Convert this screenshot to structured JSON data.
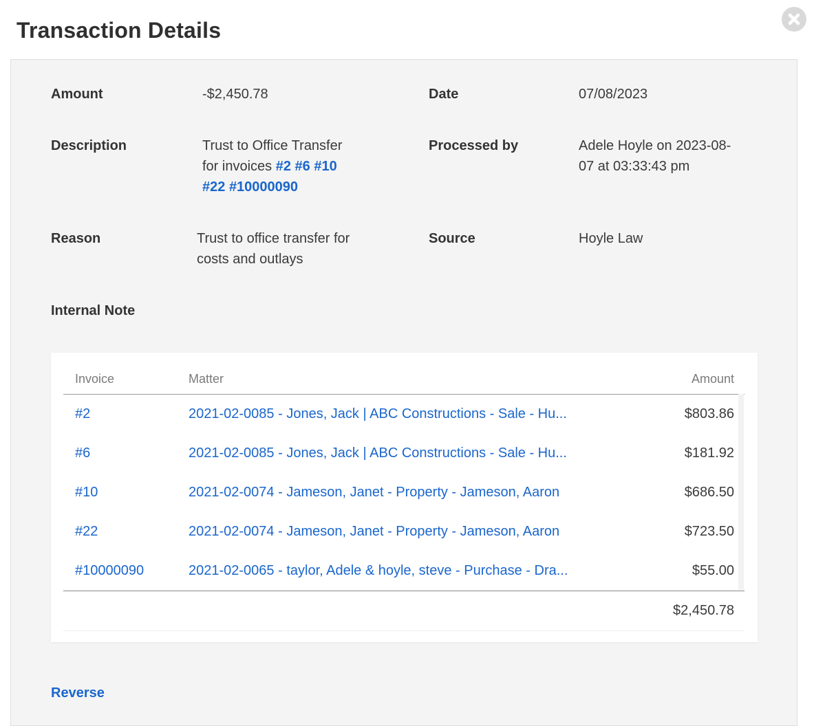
{
  "modal": {
    "title": "Transaction Details",
    "close_icon": "close-circle-icon"
  },
  "details": {
    "amount_label": "Amount",
    "amount_value": "-$2,450.78",
    "date_label": "Date",
    "date_value": "07/08/2023",
    "description_label": "Description",
    "description_text_1": "Trust to Office Transfer",
    "description_text_2": "for invoices",
    "description_links": [
      "#2",
      "#6",
      "#10",
      "#22",
      "#10000090"
    ],
    "processed_by_label": "Processed by",
    "processed_by_line_1": "Adele Hoyle on 2023-08-",
    "processed_by_line_2": "07 at 03:33:43 pm",
    "reason_label": "Reason",
    "reason_line_1": "Trust to office transfer for",
    "reason_line_2": "costs and outlays",
    "source_label": "Source",
    "source_value": "Hoyle Law",
    "internal_note_label": "Internal Note"
  },
  "invoice_table": {
    "columns": [
      "Invoice",
      "Matter",
      "Amount"
    ],
    "rows": [
      {
        "invoice": "#2",
        "matter": "2021-02-0085 - Jones, Jack | ABC Constructions - Sale - Hu...",
        "amount": "$803.86"
      },
      {
        "invoice": "#6",
        "matter": "2021-02-0085 - Jones, Jack | ABC Constructions - Sale - Hu...",
        "amount": "$181.92"
      },
      {
        "invoice": "#10",
        "matter": "2021-02-0074 - Jameson, Janet - Property - Jameson, Aaron",
        "amount": "$686.50"
      },
      {
        "invoice": "#22",
        "matter": "2021-02-0074 - Jameson, Janet - Property - Jameson, Aaron",
        "amount": "$723.50"
      },
      {
        "invoice": "#10000090",
        "matter": "2021-02-0065 - taylor, Adele & hoyle, steve - Purchase - Dra...",
        "amount": "$55.00"
      }
    ],
    "total": "$2,450.78"
  },
  "actions": {
    "reverse_label": "Reverse"
  },
  "colors": {
    "link": "#1a66cc",
    "panel_bg": "#f4f4f4",
    "close_bg": "#d9d9d9"
  }
}
